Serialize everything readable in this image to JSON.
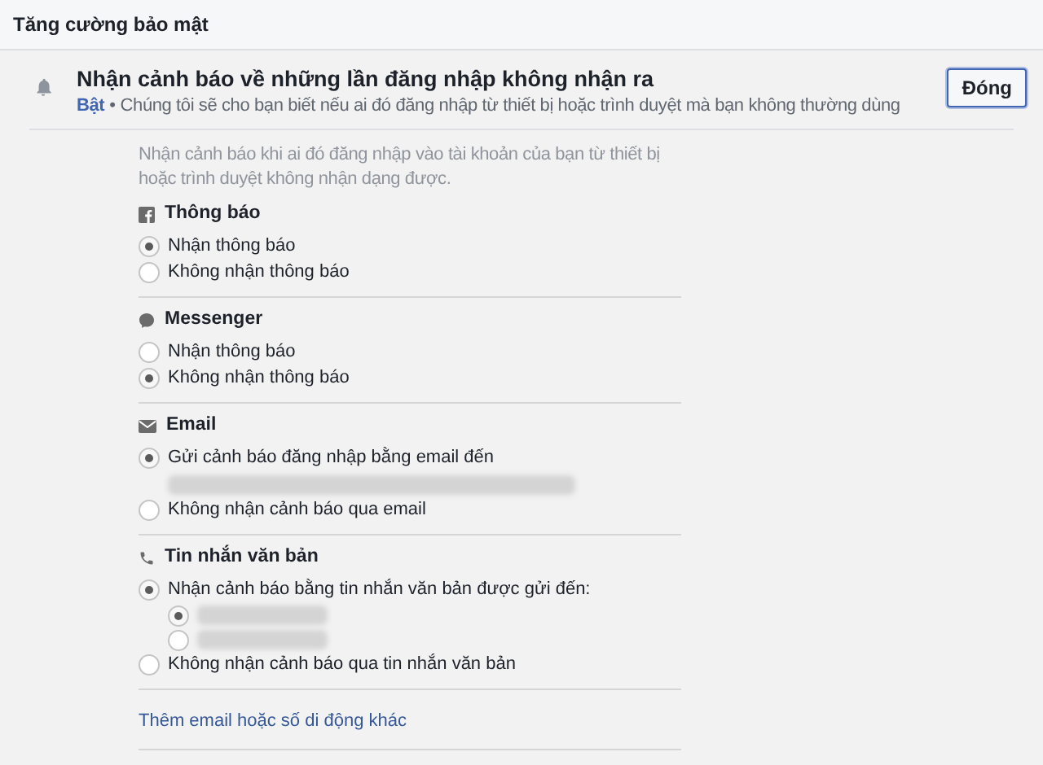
{
  "header": {
    "title": "Tăng cường bảo mật"
  },
  "alert": {
    "title": "Nhận cảnh báo về những lần đăng nhập không nhận ra",
    "status": "Bật",
    "separator": "•",
    "description": "Chúng tôi sẽ cho bạn biết nếu ai đó đăng nhập từ thiết bị hoặc trình duyệt mà bạn không thường dùng",
    "close_button": "Đóng"
  },
  "intro": "Nhận cảnh báo khi ai đó đăng nhập vào tài khoản của bạn từ thiết bị hoặc trình duyệt không nhận dạng được.",
  "sections": [
    {
      "title": "Thông báo",
      "options": [
        {
          "label": "Nhận thông báo",
          "selected": true
        },
        {
          "label": "Không nhận thông báo",
          "selected": false
        }
      ]
    },
    {
      "title": "Messenger",
      "options": [
        {
          "label": "Nhận thông báo",
          "selected": false
        },
        {
          "label": "Không nhận thông báo",
          "selected": true
        }
      ]
    },
    {
      "title": "Email",
      "options": [
        {
          "label": "Gửi cảnh báo đăng nhập bằng email đến",
          "selected": true,
          "detail": {
            "kind": "redacted"
          }
        },
        {
          "label": "Không nhận cảnh báo qua email",
          "selected": false
        }
      ]
    },
    {
      "title": "Tin nhắn văn bản",
      "options": [
        {
          "label": "Nhận cảnh báo bằng tin nhắn văn bản được gửi đến:",
          "selected": true,
          "children": [
            {
              "kind": "redacted",
              "selected": true
            },
            {
              "kind": "redacted",
              "selected": false
            }
          ]
        },
        {
          "label": "Không nhận cảnh báo qua tin nhắn văn bản",
          "selected": false
        }
      ]
    }
  ],
  "add_link": "Thêm email hoặc số di động khác"
}
